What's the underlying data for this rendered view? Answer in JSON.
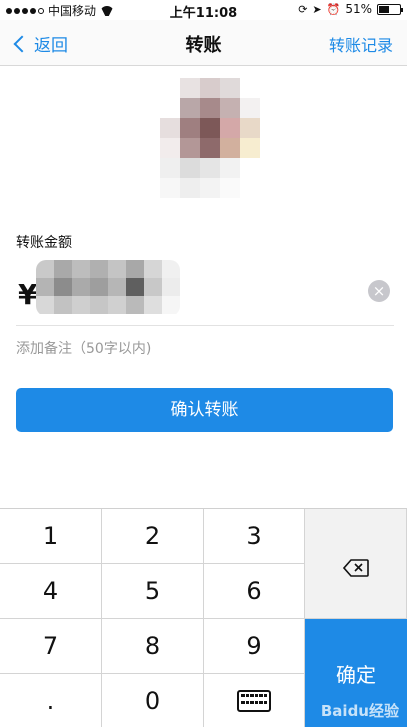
{
  "status_bar": {
    "carrier": "中国移动",
    "time": "上午11:08",
    "battery_percent": "51%",
    "battery_level": 0.51
  },
  "navbar": {
    "back_label": "返回",
    "title": "转账",
    "right_label": "转账记录"
  },
  "amount": {
    "label": "转账金额",
    "currency_symbol": "¥",
    "clear_glyph": "×"
  },
  "remark": {
    "placeholder": "添加备注（50字以内)"
  },
  "confirm_button": {
    "label": "确认转账"
  },
  "keypad": {
    "keys": [
      "1",
      "2",
      "3",
      "4",
      "5",
      "6",
      "7",
      "8",
      "9",
      ".",
      "0"
    ],
    "confirm_label": "确定",
    "delete_icon": "backspace-icon",
    "hide_icon": "keyboard-hide-icon"
  },
  "colors": {
    "accent": "#1e8ae6"
  },
  "watermark": "Baidu经验"
}
